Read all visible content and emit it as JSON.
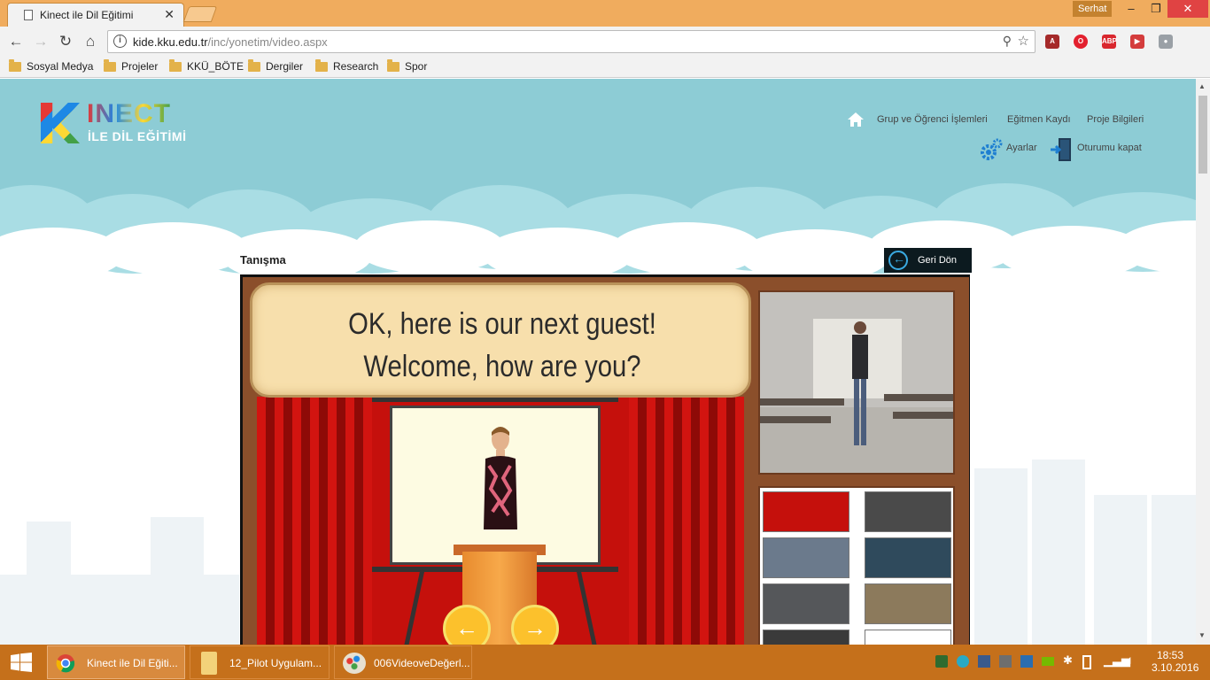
{
  "browser": {
    "tab_title": "Kinect ile Dil Eğitimi",
    "tab_close": "✕",
    "user_name": "Serhat",
    "url_host": "kide.kku.edu.tr",
    "url_path": "/inc/yonetim/video.aspx",
    "bookmarks": [
      "Sosyal Medya",
      "Projeler",
      "KKÜ_BÖTE",
      "Dergiler",
      "Research",
      "Spor"
    ],
    "extensions": [
      {
        "name": "pdf-icon",
        "color": "#a52a2a",
        "label": "A"
      },
      {
        "name": "opera-icon",
        "color": "#e3202e",
        "label": "O"
      },
      {
        "name": "adblock-icon",
        "color": "#d9272e",
        "label": "ABP"
      },
      {
        "name": "video-download-icon",
        "color": "#d43c3c",
        "label": "▶"
      },
      {
        "name": "extension-icon",
        "color": "#9aa0a6",
        "label": "●"
      }
    ]
  },
  "site": {
    "logo_main": "INECT",
    "logo_sub": "İLE DİL EĞİTİMİ",
    "nav": {
      "groups": "Grup ve Öğrenci İşlemleri",
      "trainer": "Eğitmen Kaydı",
      "project": "Proje Bilgileri",
      "settings": "Ayarlar",
      "logout": "Oturumu kapat"
    },
    "section_title": "Tanışma",
    "back_label": "Geri Dön"
  },
  "game": {
    "bubble_text": "OK, here is our next guest! Welcome, how are you?"
  },
  "taskbar": {
    "items": [
      {
        "label": "Kinect ile Dil Eğiti...",
        "icon": "chrome-icon"
      },
      {
        "label": "12_Pilot Uygulam...",
        "icon": "folder-icon"
      },
      {
        "label": "006VideoveDeğerl...",
        "icon": "paint-icon"
      }
    ],
    "time": "18:53",
    "date": "3.10.2016"
  },
  "colors": {
    "titlebar": "#f0ac5e",
    "sky": "#8dccd5",
    "taskbar": "#c5701b"
  }
}
